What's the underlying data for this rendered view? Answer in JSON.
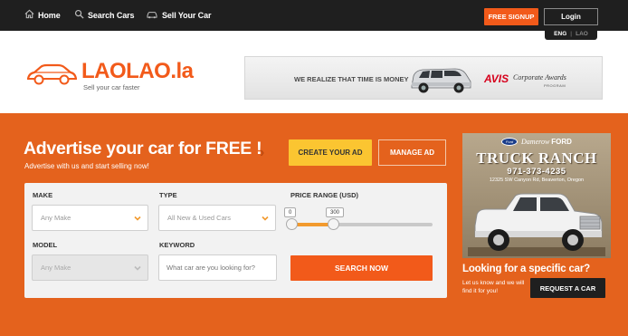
{
  "topbar": {
    "home_label": "Home",
    "search_label": "Search Cars",
    "sell_label": "Sell Your Car",
    "signup_label": "FREE SIGNUP",
    "login_label": "Login",
    "lang_active": "ENG",
    "lang_separator": "|",
    "lang_other": "LAO"
  },
  "brand": {
    "name": "LAOLAO.la",
    "tagline": "Sell your car faster",
    "accent_color": "#f25a1a"
  },
  "banner": {
    "text": "WE REALIZE THAT TIME IS MONEY",
    "brand": "AVIS",
    "award": "Corporate Awards",
    "program": "PROGRAM"
  },
  "hero": {
    "headline": "Advertise your car for FREE !",
    "subline": "Advertise with us and start selling now!",
    "create_label": "CREATE YOUR AD",
    "manage_label": "MANAGE AD",
    "background_color": "#e4621d"
  },
  "search": {
    "make_label": "MAKE",
    "make_value": "Any Make",
    "type_label": "TYPE",
    "type_value": "All New & Used Cars",
    "price_label": "PRICE RANGE (USD)",
    "price_min": "0",
    "price_max": "300",
    "model_label": "MODEL",
    "model_value": "Any Make",
    "keyword_label": "KEYWORD",
    "keyword_placeholder": "What car are you looking for?",
    "search_label": "SEARCH NOW"
  },
  "ad": {
    "dealer": "Damerow",
    "brand": "FORD",
    "logo_text": "Ford",
    "title": "TRUCK RANCH",
    "phone": "971-373-4235",
    "address": "12325 SW Canyon Rd, Beaverton, Oregon"
  },
  "request": {
    "heading": "Looking for a specific car?",
    "text": "Let us know and we will find it for you!",
    "button_label": "REQUEST A CAR"
  }
}
